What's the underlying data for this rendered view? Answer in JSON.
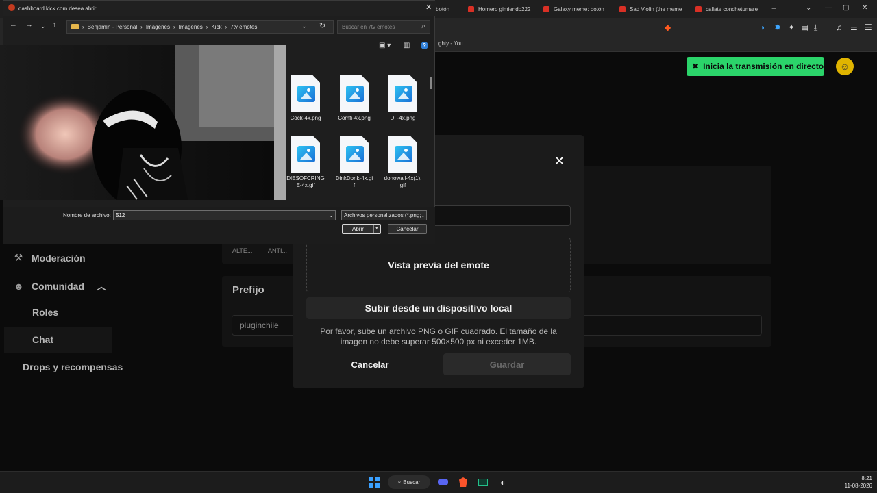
{
  "browser": {
    "tabs": [
      {
        "label": "botón"
      },
      {
        "label": "Homero gimiendo222"
      },
      {
        "label": "Galaxy meme: botón"
      },
      {
        "label": "Sad Violin (the meme"
      },
      {
        "label": "callate conchetumare"
      }
    ],
    "new_tab": "+",
    "bookmark_partial": "ghty - You..."
  },
  "kick": {
    "go_live_label": "Inicia la transmisión en directo",
    "sidebar": [
      {
        "label": "Moderación"
      },
      {
        "label": "Comunidad"
      },
      {
        "label": "Roles"
      },
      {
        "label": "Chat"
      },
      {
        "label": "Drops y recompensas"
      }
    ],
    "filters": [
      "ALTE...",
      "ANTI..."
    ],
    "prefix_title": "Prefijo",
    "prefix_value": "pluginchile"
  },
  "modal": {
    "close": "✕",
    "preview_label": "Vista previa del emote",
    "upload_label": "Subir desde un dispositivo local",
    "hint": "Por favor, sube un archivo PNG o GIF cuadrado. El tamaño de la imagen no debe superar 500×500 px ni exceder 1MB.",
    "cancel_label": "Cancelar",
    "save_label": "Guardar"
  },
  "file_dialog": {
    "title": "dashboard.kick.com desea abrir",
    "breadcrumb": [
      "Benjamín - Personal",
      "Imágenes",
      "Imágenes",
      "Kick",
      "7tv emotes"
    ],
    "search_placeholder": "Buscar en 7tv emotes",
    "files": [
      {
        "name": "Cock-4x.png"
      },
      {
        "name": "Comfi-4x.png"
      },
      {
        "name": "D_-4x.png"
      },
      {
        "name": "DIESOFCRINGE-4x.gif"
      },
      {
        "name": "DinkDonk-4x.gif"
      },
      {
        "name": "donowall-4x(1).gif"
      }
    ],
    "filename_label": "Nombre de archivo:",
    "filename_value": "512",
    "filter_label": "Archivos personalizados (*.png;",
    "open_label": "Abrir",
    "cancel_label": "Cancelar"
  },
  "taskbar": {
    "search_label": "Buscar",
    "time": "8:21",
    "date": "11-08-2026"
  }
}
